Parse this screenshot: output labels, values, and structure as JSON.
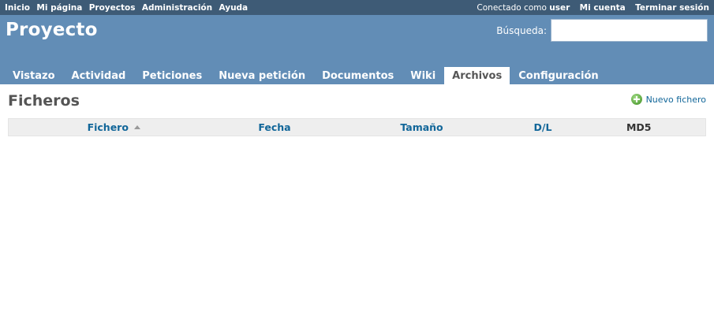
{
  "top_menu": {
    "left_links": [
      "Inicio",
      "Mi página",
      "Proyectos",
      "Administración",
      "Ayuda"
    ],
    "logged_as_prefix": "Conectado como",
    "logged_user": "user",
    "right_links": [
      "Mi cuenta",
      "Terminar sesión"
    ]
  },
  "header": {
    "title": "Proyecto",
    "search_label": "Búsqueda:",
    "search_value": ""
  },
  "main_menu": {
    "tabs": [
      "Vistazo",
      "Actividad",
      "Peticiones",
      "Nueva petición",
      "Documentos",
      "Wiki",
      "Archivos",
      "Configuración"
    ],
    "selected": "Archivos"
  },
  "content": {
    "title": "Ficheros",
    "new_file_label": "Nuevo fichero",
    "columns": [
      "Fichero",
      "Fecha",
      "Tamaño",
      "D/L",
      "MD5"
    ],
    "rows": []
  },
  "icons": {
    "new_file": "add-icon",
    "sort": "sort-ascending-icon"
  },
  "colors": {
    "top_menu_bg": "#3e5b76",
    "header_bg": "#628db6",
    "link": "#116699",
    "table_header_bg": "#eeeeee"
  }
}
